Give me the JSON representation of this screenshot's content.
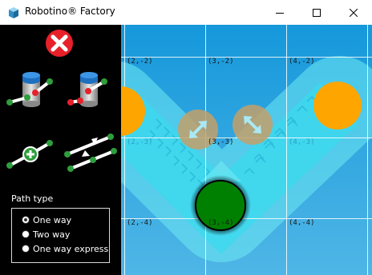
{
  "window": {
    "title": "Robotino® Factory"
  },
  "sidebar": {
    "tools": [
      {
        "icon": "delete-icon"
      },
      {
        "icon": "station-link-icon"
      },
      {
        "icon": "station-unlink-icon"
      },
      {
        "icon": "add-path-icon"
      },
      {
        "icon": "multi-path-icon"
      }
    ],
    "path_type": {
      "label": "Path type",
      "options": [
        {
          "label": "One way",
          "checked": true
        },
        {
          "label": "Two way",
          "checked": false
        },
        {
          "label": "One way express",
          "checked": false
        }
      ]
    }
  },
  "map": {
    "coords": [
      "(2,-2)",
      "(3,-2)",
      "(4,-2)",
      "(2,-3)",
      "(3,-3)",
      "(4,-3)",
      "(2,-4)",
      "(3,-4)",
      "(4,-4)"
    ],
    "colors": {
      "background": "#1fa0dc",
      "grid": "#ffffff",
      "path": "#4fe6f0",
      "station": "#ffa500",
      "robot": "#008000"
    }
  }
}
